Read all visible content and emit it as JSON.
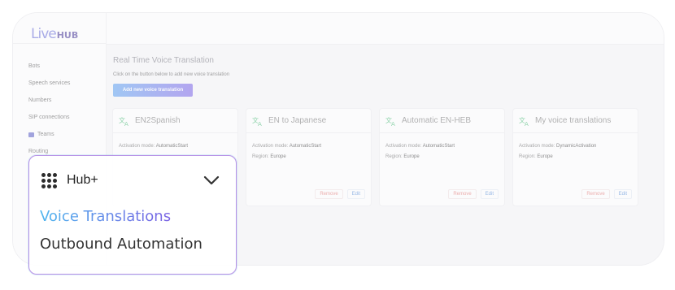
{
  "app": {
    "logo_part1": "Live",
    "logo_part2": "HUB"
  },
  "sidebar": {
    "items": [
      {
        "label": "Bots"
      },
      {
        "label": "Speech services"
      },
      {
        "label": "Numbers"
      },
      {
        "label": "SIP connections"
      },
      {
        "label": "Teams",
        "icon": "teams-icon"
      },
      {
        "label": "Routing"
      }
    ]
  },
  "main": {
    "title": "Real Time Voice Translation",
    "subtitle": "Click on the button below to add new voice translation",
    "add_button": "Add new voice translation"
  },
  "cards": [
    {
      "title": "EN2Spanish",
      "mode_label": "Activation mode:",
      "mode": "AutomaticStart",
      "region_label": "",
      "region": "",
      "remove": "",
      "edit": ""
    },
    {
      "title": "EN to Japanese",
      "mode_label": "Activation mode:",
      "mode": "AutomaticStart",
      "region_label": "Region:",
      "region": "Europe",
      "remove": "Remove",
      "edit": "Edit"
    },
    {
      "title": "Automatic EN-HEB",
      "mode_label": "Activation mode:",
      "mode": "AutomaticStart",
      "region_label": "Region:",
      "region": "Europe",
      "remove": "Remove",
      "edit": "Edit"
    },
    {
      "title": "My voice translations",
      "mode_label": "Activation mode:",
      "mode": "DynamicActivation",
      "region_label": "Region:",
      "region": "Europe",
      "remove": "Remove",
      "edit": "Edit"
    }
  ],
  "dropdown": {
    "title": "Hub+",
    "items": [
      {
        "label": "Voice Translations",
        "active": true
      },
      {
        "label": "Outbound Automation",
        "active": false
      }
    ]
  },
  "colors": {
    "accent_start": "#4fb6ee",
    "accent_end": "#7b63e4",
    "remove": "#e2706e",
    "edit": "#4a86d6",
    "translate_icon": "#3fb86f"
  }
}
